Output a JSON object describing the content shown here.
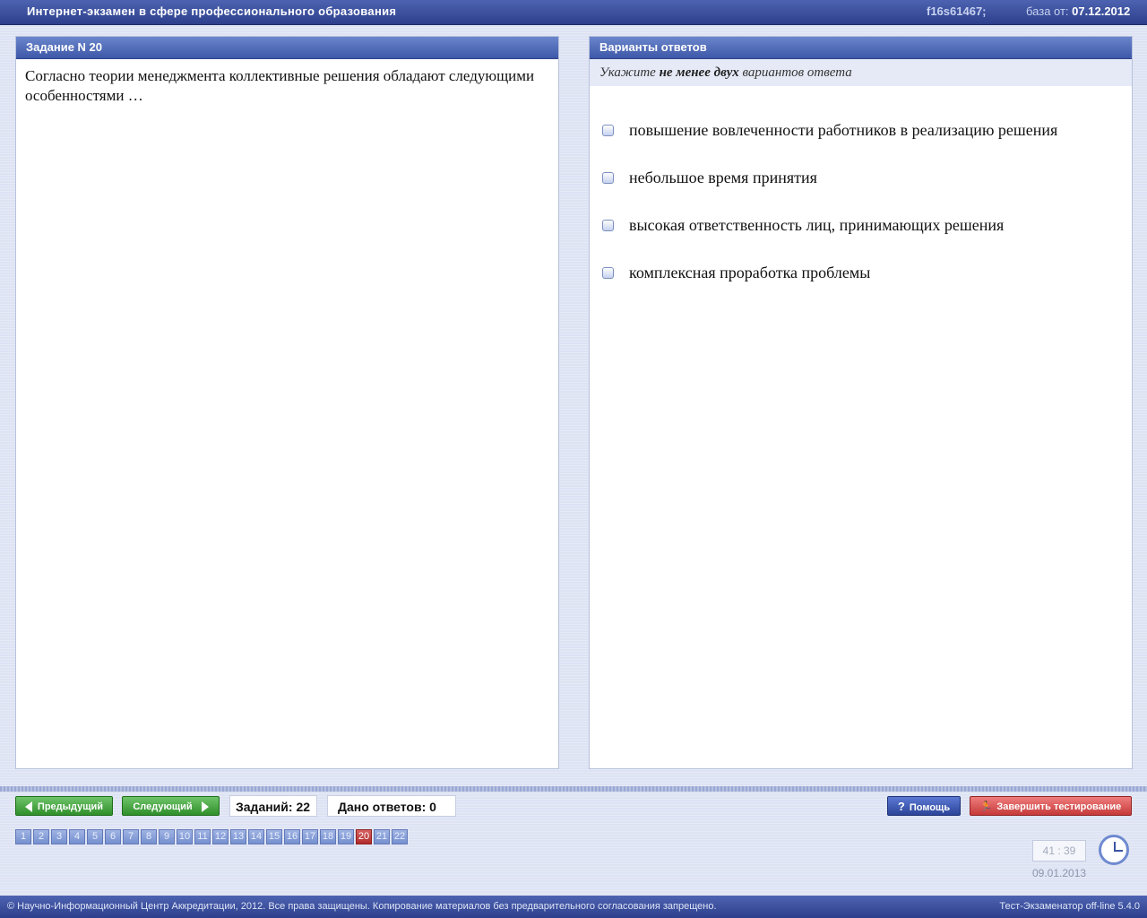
{
  "header": {
    "title": "Интернет-экзамен в сфере профессионального образования",
    "session_id": "f16s61467;",
    "base_label": "база от:",
    "base_date": "07.12.2012"
  },
  "task": {
    "heading": "Задание N 20",
    "question": "Согласно теории  менеджмента коллективные решения обладают следующими особенностями …"
  },
  "answers": {
    "heading": "Варианты ответов",
    "hint_prefix": "Укажите ",
    "hint_bold": "не менее двух",
    "hint_suffix": " вариантов ответа",
    "options": [
      {
        "label": "повышение вовлеченности работников в реализацию решения",
        "checked": false
      },
      {
        "label": "небольшое время принятия",
        "checked": false
      },
      {
        "label": "высокая ответственность лиц, принимающих решения",
        "checked": false
      },
      {
        "label": "комплексная проработка проблемы",
        "checked": false
      }
    ]
  },
  "nav": {
    "prev_label": "Предыдущий",
    "next_label": "Следующий",
    "tasks_count": "Заданий: 22",
    "answers_given": "Дано ответов: 0",
    "help_label": "Помощь",
    "finish_label": "Завершить тестирование",
    "pages": [
      "1",
      "2",
      "3",
      "4",
      "5",
      "6",
      "7",
      "8",
      "9",
      "10",
      "11",
      "12",
      "13",
      "14",
      "15",
      "16",
      "17",
      "18",
      "19",
      "20",
      "21",
      "22"
    ],
    "current_page": "20"
  },
  "timer": {
    "value": "41 : 39",
    "date": "09.01.2013"
  },
  "footer": {
    "copyright": "© Научно-Информационный Центр Аккредитации, 2012. Все права защищены. Копирование материалов без предварительного согласования запрещено.",
    "version": "Тест-Экзаменатор off-line 5.4.0"
  },
  "colors": {
    "header": "#3a4fa0",
    "active_page": "#c23a3a",
    "nav_green": "#3f9a3a",
    "help_blue": "#3a55b0",
    "finish_red": "#d14e4e"
  }
}
